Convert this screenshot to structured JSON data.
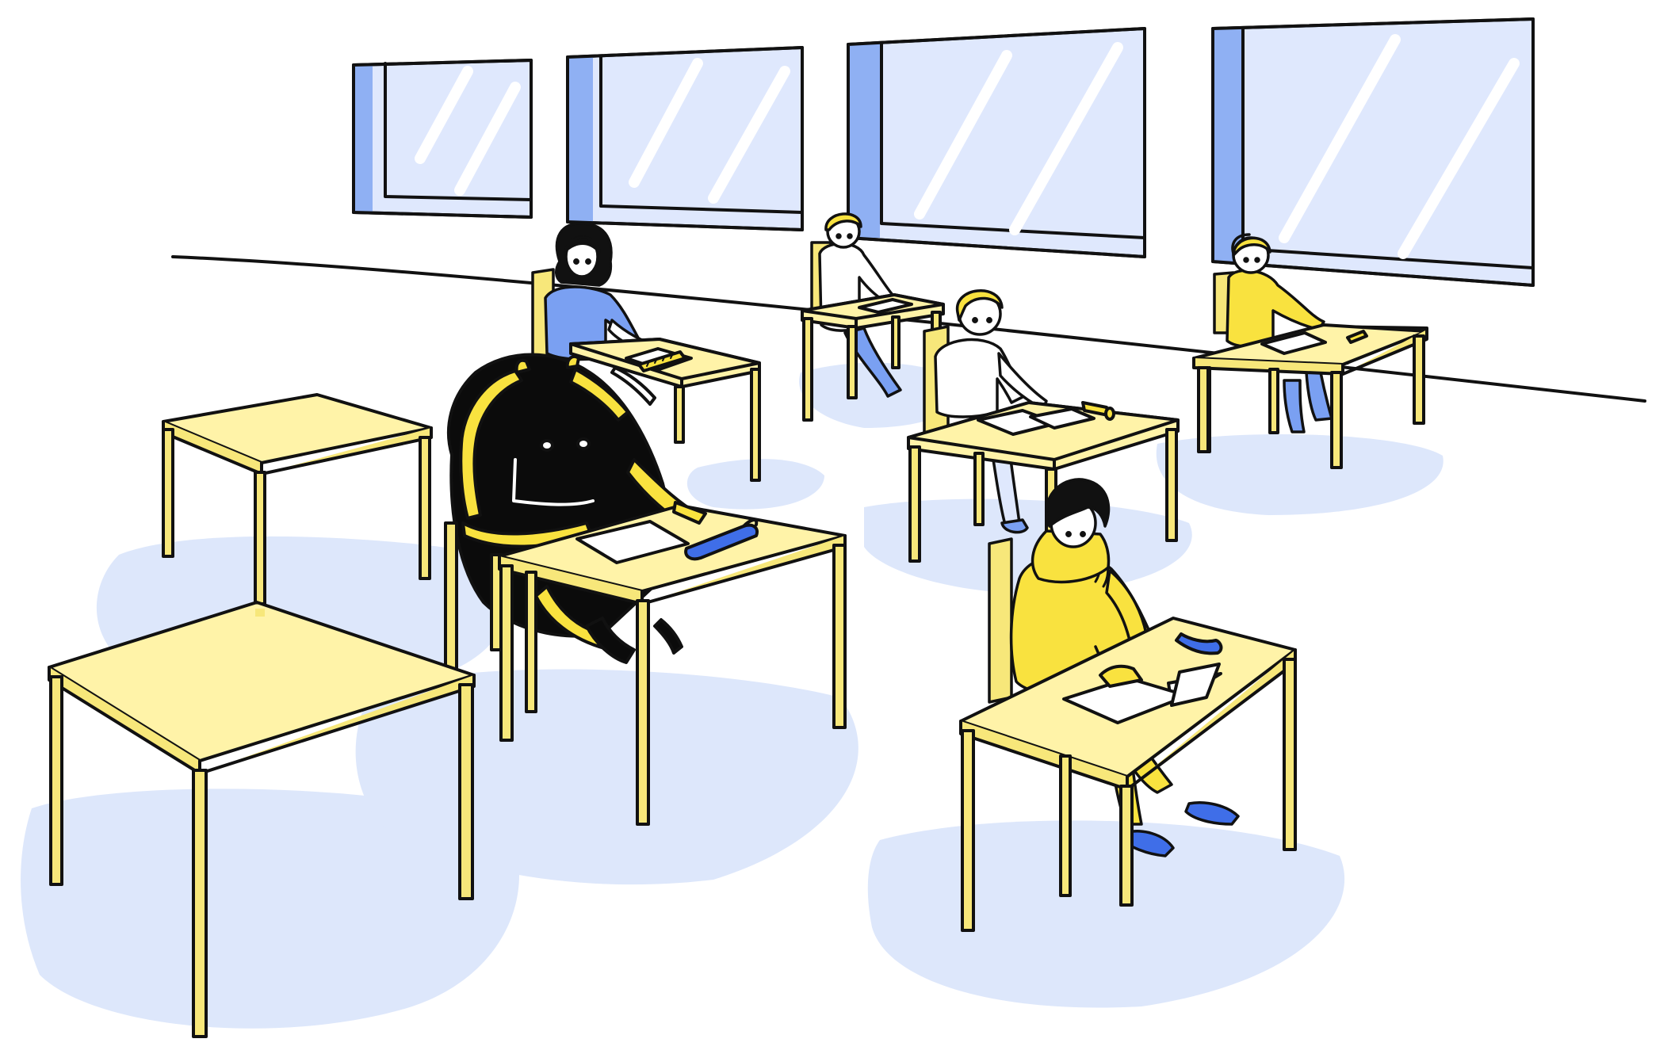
{
  "palette": {
    "outline": "#111111",
    "desk_yellow": "#fff3a8",
    "desk_leg_yellow": "#f7e77a",
    "bright_yellow": "#f9e23f",
    "shadow_blue": "#dde7fb",
    "window_glass": "#dfe8fd",
    "window_frame_blue": "#8fb0f3",
    "shirt_blue": "#7aa0f2",
    "dark_blue": "#3f6ee8",
    "monster_black": "#0b0b0b",
    "paper": "#ffffff"
  },
  "scene": {
    "subject": "classroom",
    "characters": [
      "student-girl-blue-shirt",
      "monster-student",
      "student-boy-back-row",
      "student-boy-middle",
      "student-girl-yellow",
      "student-boy-yellow-hoodie"
    ],
    "windows": 4,
    "empty_desks": 2
  }
}
